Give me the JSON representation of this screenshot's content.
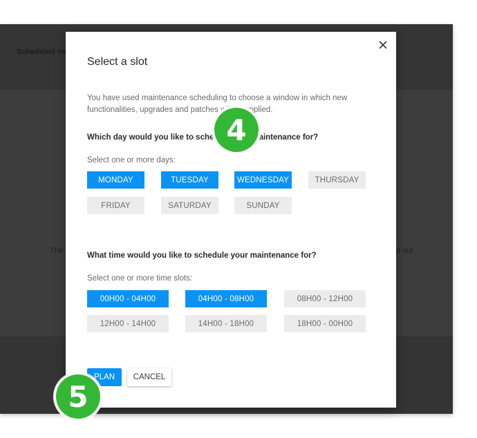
{
  "background": {
    "header_title": "Scheduled ma",
    "left_text": "The",
    "right_text": "d out"
  },
  "modal": {
    "title": "Select a slot",
    "intro": "You have used maintenance scheduling to choose a window in which new functionalities, upgrades and patches will be applied.",
    "day_question": "Which day would you like to schedule your maintenance for?",
    "day_hint": "Select one or more days:",
    "days": [
      {
        "label": "MONDAY",
        "selected": true
      },
      {
        "label": "TUESDAY",
        "selected": true
      },
      {
        "label": "WEDNESDAY",
        "selected": true
      },
      {
        "label": "THURSDAY",
        "selected": false
      },
      {
        "label": "FRIDAY",
        "selected": false
      },
      {
        "label": "SATURDAY",
        "selected": false
      },
      {
        "label": "SUNDAY",
        "selected": false
      }
    ],
    "time_question": "What time would you like to schedule your maintenance for?",
    "time_hint": "Select one or more time slots:",
    "slots": [
      {
        "label": "00H00 - 04H00",
        "selected": true
      },
      {
        "label": "04H00 - 08H00",
        "selected": true
      },
      {
        "label": "08H00 - 12H00",
        "selected": false
      },
      {
        "label": "12H00 - 14H00",
        "selected": false
      },
      {
        "label": "14H00 - 18H00",
        "selected": false
      },
      {
        "label": "18H00 - 00H00",
        "selected": false
      }
    ],
    "plan_label": "PLAN",
    "cancel_label": "CANCEL",
    "close_icon": "close-icon"
  },
  "badges": {
    "step_4": "4",
    "step_5": "5"
  },
  "colors": {
    "accent": "#0a93f5",
    "chip_idle": "#ececec",
    "badge": "#35b736",
    "overlay": "#3d3d3d"
  }
}
